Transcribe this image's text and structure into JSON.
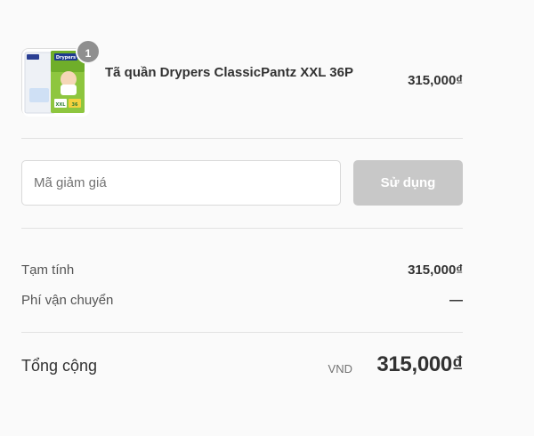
{
  "order": {
    "items": [
      {
        "name": "Tã quần Drypers ClassicPantz XXL 36P",
        "quantity": "1",
        "price": "315,000₫",
        "thumbnail_text": {
          "brand": "Drypers",
          "product_line": "Classic Pantz",
          "size": "XXL",
          "count": "36"
        }
      }
    ]
  },
  "discount": {
    "placeholder": "Mã giảm giá",
    "value": "",
    "apply_label": "Sử dụng"
  },
  "totals": {
    "subtotal_label": "Tạm tính",
    "subtotal_value": "315,000₫",
    "shipping_label": "Phí vận chuyển",
    "shipping_value": "—",
    "total_label": "Tổng cộng",
    "currency": "VND",
    "total_value": "315,000₫"
  },
  "colors": {
    "background": "#fafafa",
    "badge": "#8f8f8f",
    "button_disabled": "#c8c8c8",
    "text": "#323232",
    "muted": "#737373"
  }
}
